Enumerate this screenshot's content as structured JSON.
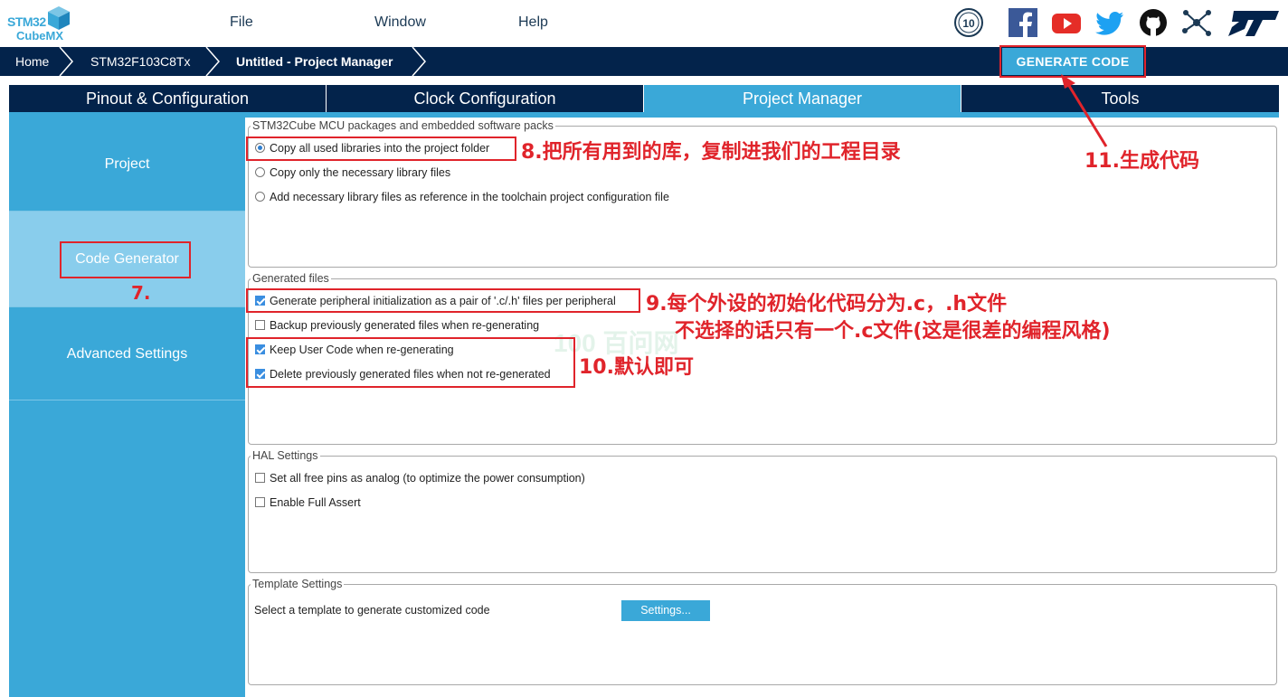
{
  "app": {
    "logo_line1": "STM32",
    "logo_line2": "CubeMX",
    "brand_color": "#3aa8d8",
    "navy_color": "#03234b"
  },
  "menu": {
    "file": "File",
    "window": "Window",
    "help": "Help"
  },
  "social_icons": [
    "anniversary-10-icon",
    "facebook-icon",
    "youtube-icon",
    "twitter-icon",
    "github-icon",
    "network-share-icon",
    "st-logo-icon"
  ],
  "breadcrumb": {
    "home": "Home",
    "device": "STM32F103C8Tx",
    "project": "Untitled - Project Manager"
  },
  "generate_button": "GENERATE CODE",
  "tabs": [
    {
      "label": "Pinout & Configuration",
      "active": false
    },
    {
      "label": "Clock Configuration",
      "active": false
    },
    {
      "label": "Project Manager",
      "active": true
    },
    {
      "label": "Tools",
      "active": false
    }
  ],
  "sidebar": {
    "items": [
      {
        "label": "Project",
        "active": false
      },
      {
        "label": "Code Generator",
        "active": true
      },
      {
        "label": "Advanced Settings",
        "active": false
      }
    ]
  },
  "packages_group": {
    "title": "STM32Cube MCU packages and embedded software packs",
    "options": [
      {
        "label": "Copy all used libraries into the project folder",
        "selected": true
      },
      {
        "label": "Copy only the necessary library files",
        "selected": false
      },
      {
        "label": "Add necessary library files as reference in the toolchain project configuration file",
        "selected": false
      }
    ]
  },
  "generated_files_group": {
    "title": "Generated files",
    "options": [
      {
        "label": "Generate peripheral initialization as a pair of '.c/.h' files per peripheral",
        "checked": true
      },
      {
        "label": "Backup previously generated files when re-generating",
        "checked": false
      },
      {
        "label": "Keep User Code when re-generating",
        "checked": true
      },
      {
        "label": "Delete previously generated files when not re-generated",
        "checked": true
      }
    ]
  },
  "hal_group": {
    "title": "HAL Settings",
    "options": [
      {
        "label": "Set all free pins as analog (to optimize the power consumption)",
        "checked": false
      },
      {
        "label": "Enable Full Assert",
        "checked": false
      }
    ]
  },
  "template_group": {
    "title": "Template Settings",
    "description": "Select a template to generate customized code",
    "button": "Settings..."
  },
  "annotations": {
    "a7": "7.",
    "a8": "8.把所有用到的库，复制进我们的工程目录",
    "a9_line1": "9.每个外设的初始化代码分为.c，.h文件",
    "a9_line2": "不选择的话只有一个.c文件(这是很差的编程风格)",
    "a10": "10.默认即可",
    "a11": "11.生成代码",
    "color": "#e0242b"
  },
  "watermark": "100 百问网"
}
